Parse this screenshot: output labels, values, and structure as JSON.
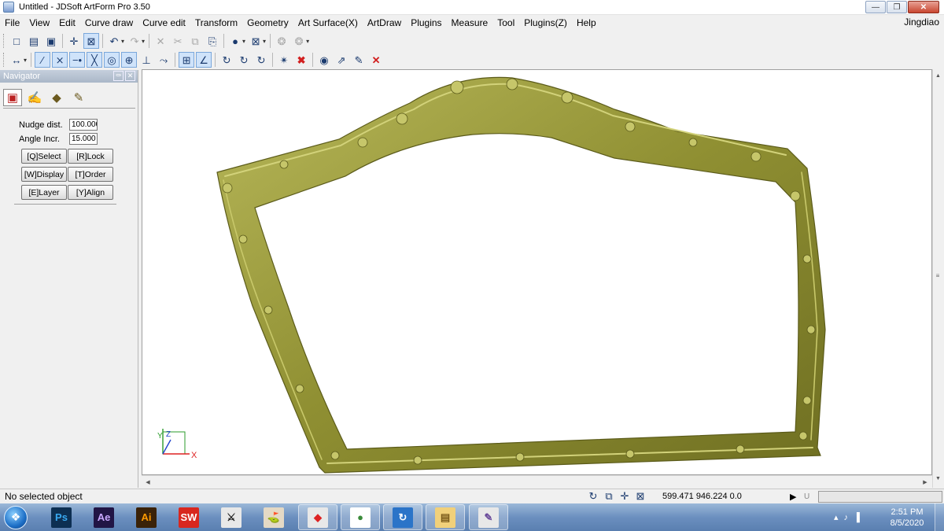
{
  "window": {
    "title": "Untitled - JDSoft ArtForm Pro 3.50",
    "controls": {
      "minimize": "—",
      "restore": "❐",
      "close": "✕"
    }
  },
  "menu": {
    "items": [
      "File",
      "View",
      "Edit",
      "Curve draw",
      "Curve edit",
      "Transform",
      "Geometry",
      "Art Surface(X)",
      "ArtDraw",
      "Plugins",
      "Measure",
      "Tool",
      "Plugins(Z)",
      "Help"
    ],
    "user": "Jingdiao"
  },
  "toolbar1": {
    "icons": [
      "new-file-icon",
      "open-folder-icon",
      "save-icon",
      "crosshair-icon",
      "select-box-icon",
      "undo-icon",
      "redo-icon",
      "delete-icon",
      "cut-icon",
      "copy-icon",
      "paste-icon",
      "sphere-shading-icon",
      "wireframe-box-icon",
      "light-icon",
      "light-settings-icon"
    ],
    "glyphs": [
      "□",
      "▤",
      "▣",
      "✛",
      "⊠",
      "↶",
      "↷",
      "✕",
      "✂",
      "⧉",
      "⎘",
      "●",
      "⊠",
      "❂",
      "❂"
    ]
  },
  "toolbar2": {
    "icons": [
      "snap-mode-icon",
      "line-draw-icon",
      "curve-intersect-icon",
      "point-on-curve-icon",
      "cross-icon",
      "circle-center-icon",
      "tangent-circle-icon",
      "perpendicular-icon",
      "extend-icon",
      "grid-snap-icon",
      "angle-snap-icon",
      "rotate-view-1-icon",
      "rotate-view-2-icon",
      "rotate-view-3-icon",
      "trim-icon",
      "delete-node-icon",
      "eye-icon",
      "measure-icon",
      "note-edit-icon",
      "close-red-icon"
    ],
    "glyphs": [
      "↔",
      "∕",
      "⨯",
      "−•",
      "╳",
      "◎",
      "⊕",
      "⊥",
      "⤳",
      "⊞",
      "∠",
      "↻",
      "↻",
      "↻",
      "✴",
      "✖",
      "◉",
      "⇗",
      "✎",
      "✕"
    ]
  },
  "navigator": {
    "title": "Navigator",
    "tabs": [
      "▣",
      "✍",
      "◆",
      "✎"
    ],
    "nudge_label": "Nudge dist.",
    "nudge_value": "100.000",
    "angle_label": "Angle Incr.",
    "angle_value": "15.000",
    "buttons": [
      "[Q]Select",
      "[R]Lock",
      "[W]Display",
      "[T]Order",
      "[E]Layer",
      "[Y]Align"
    ]
  },
  "viewport": {
    "axis_x": "X",
    "axis_z": "Z",
    "axis_y": "Y",
    "model_color": "#9a9a3a"
  },
  "status": {
    "message": "No selected object",
    "coordinates": "599.471 946.224 0.0",
    "indicator_u": "U",
    "icons": [
      "↻",
      "⧉",
      "✛",
      "⊠"
    ]
  },
  "taskbar": {
    "apps": [
      {
        "name": "Ps",
        "bg": "#0d2f52",
        "fg": "#38a8f0"
      },
      {
        "name": "Ae",
        "bg": "#211545",
        "fg": "#c9a8ff"
      },
      {
        "name": "Ai",
        "bg": "#3a2208",
        "fg": "#ff9a00"
      },
      {
        "name": "SW",
        "bg": "#d8271f",
        "fg": "#ffffff"
      },
      {
        "name": "⚔",
        "bg": "#e8e8e8",
        "fg": "#222"
      },
      {
        "name": "⛳",
        "bg": "#e4d9c5",
        "fg": "#555"
      },
      {
        "name": "◆",
        "bg": "#e8e8e8",
        "fg": "#d22"
      },
      {
        "name": "●",
        "bg": "#ffffff",
        "fg": "#3a8b3a"
      },
      {
        "name": "↻",
        "bg": "#2b74c8",
        "fg": "#ffffff"
      },
      {
        "name": "▤",
        "bg": "#f1d07a",
        "fg": "#7a5a1a"
      },
      {
        "name": "✎",
        "bg": "#e8e8e8",
        "fg": "#6a4a9a"
      }
    ],
    "tray": [
      "▴",
      "♪",
      "▐"
    ],
    "time": "2:51 PM",
    "date": "8/5/2020"
  }
}
